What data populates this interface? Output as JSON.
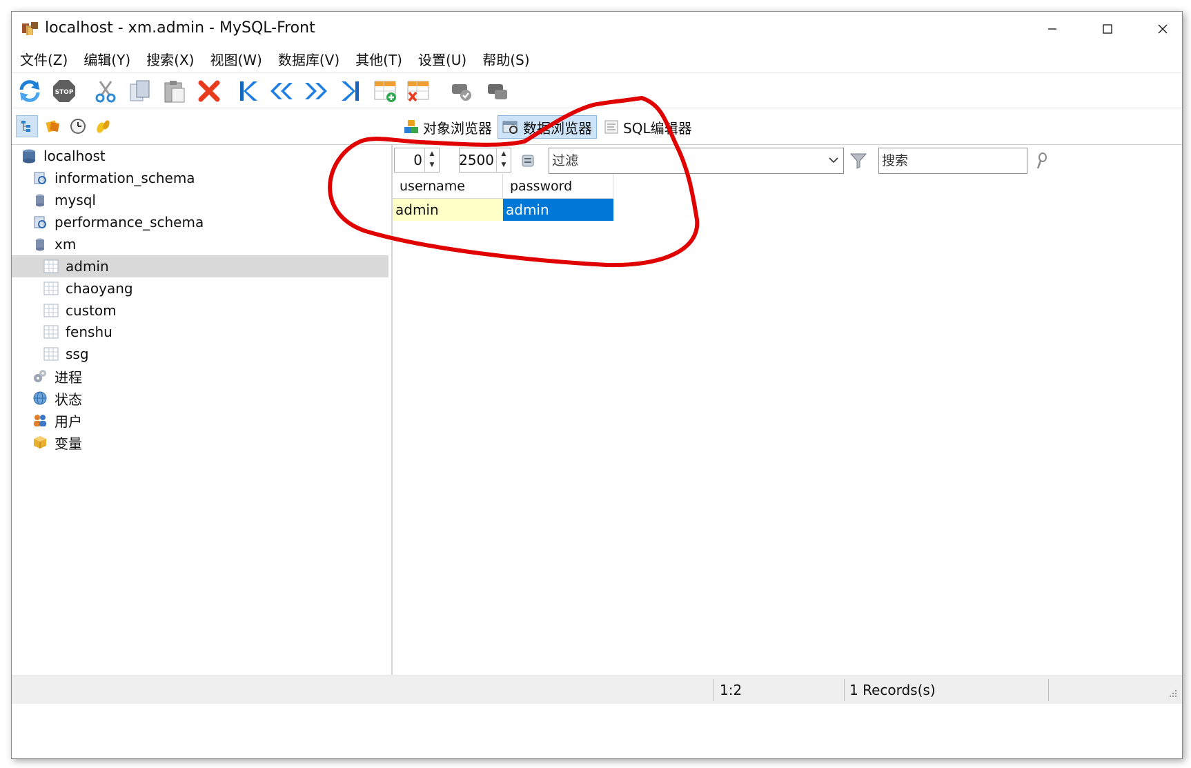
{
  "window": {
    "title": "localhost - xm.admin - MySQL-Front"
  },
  "menu": {
    "items": [
      "文件(Z)",
      "编辑(Y)",
      "搜索(X)",
      "视图(W)",
      "数据库(V)",
      "其他(T)",
      "设置(U)",
      "帮助(S)"
    ]
  },
  "toolbar": {
    "buttons": [
      "refresh-icon",
      "stop-icon",
      "cut-icon",
      "copy-icon",
      "paste-icon",
      "delete-icon",
      "first-icon",
      "prev-page-icon",
      "next-page-icon",
      "last-icon",
      "insert-row-icon",
      "delete-row-icon",
      "post-icon",
      "cancel-icon"
    ]
  },
  "views": {
    "tabs": [
      {
        "label": "对象浏览器",
        "active": false
      },
      {
        "label": "数据浏览器",
        "active": true
      },
      {
        "label": "SQL编辑器",
        "active": false
      }
    ]
  },
  "tree": {
    "nodes": [
      {
        "label": "localhost",
        "icon": "server-icon",
        "level": 0
      },
      {
        "label": "information_schema",
        "icon": "system-database-icon",
        "level": 1
      },
      {
        "label": "mysql",
        "icon": "database-icon",
        "level": 1
      },
      {
        "label": "performance_schema",
        "icon": "system-database-icon",
        "level": 1
      },
      {
        "label": "xm",
        "icon": "database-icon",
        "level": 1
      },
      {
        "label": "admin",
        "icon": "table-icon",
        "level": 2,
        "selected": true
      },
      {
        "label": "chaoyang",
        "icon": "table-icon",
        "level": 2
      },
      {
        "label": "custom",
        "icon": "table-icon",
        "level": 2
      },
      {
        "label": "fenshu",
        "icon": "table-icon",
        "level": 2
      },
      {
        "label": "ssg",
        "icon": "table-icon",
        "level": 2
      },
      {
        "label": "进程",
        "icon": "process-icon",
        "level": 1
      },
      {
        "label": "状态",
        "icon": "status-icon",
        "level": 1
      },
      {
        "label": "用户",
        "icon": "users-icon",
        "level": 1
      },
      {
        "label": "变量",
        "icon": "variables-icon",
        "level": 1
      }
    ]
  },
  "data_browser": {
    "offset": "0",
    "limit": "2500",
    "filter_placeholder": "过滤",
    "search_placeholder": "搜索",
    "columns": [
      "username",
      "password"
    ],
    "rows": [
      [
        "admin",
        "admin"
      ]
    ]
  },
  "status": {
    "position": "1:2",
    "records": "1 Records(s)"
  },
  "colors": {
    "selection": "#0078d7",
    "current_cell": "#ffffc8",
    "annotation": "#e00000"
  }
}
